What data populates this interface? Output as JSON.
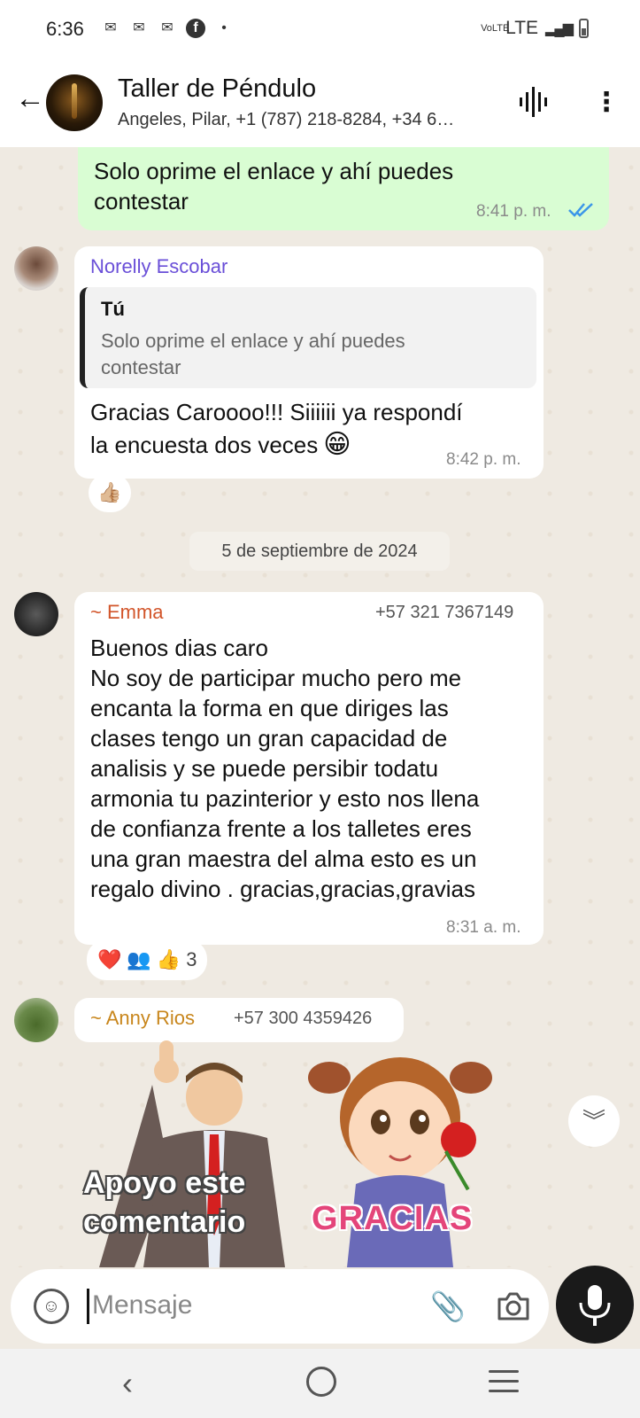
{
  "status_bar": {
    "time": "6:36",
    "network": "LTE",
    "volte": "VoLTE"
  },
  "header": {
    "title": "Taller de Péndulo",
    "subtitle": "Angeles, Pilar, +1 (787) 218-8284, +34 6…"
  },
  "messages": {
    "outgoing_1": {
      "text_line1": "Solo oprime el enlace y ahí puedes",
      "text_line2": "contestar",
      "time": "8:41 p. m."
    },
    "norelly": {
      "sender": "Norelly Escobar",
      "quote_author": "Tú",
      "quote_line1": "Solo oprime el enlace y ahí puedes",
      "quote_line2": "contestar",
      "text_line1": "Gracias Caroooo!!! Siiiiii ya respondí",
      "text_line2": "la encuesta dos veces",
      "emoji": "😁",
      "time": "8:42 p. m.",
      "reaction": "👍🏼"
    },
    "date_separator": "5 de septiembre de 2024",
    "emma": {
      "sender": "~ Emma",
      "phone": "+57 321 7367149",
      "lines": [
        "Buenos dias caro",
        "No soy de participar mucho pero me",
        "encanta  la forma en que diriges las",
        "clases tengo un gran capacidad de",
        "analisis y se puede persibir  todatu",
        "armonia  tu pazinterior y esto nos llena",
        "de confianza frente a los talletes eres",
        "una gran maestra del alma esto es un",
        "regalo divino . gracias,gracias,gravias"
      ],
      "time": "8:31 a. m.",
      "reactions": [
        "❤️",
        "👥",
        "👍"
      ],
      "reaction_count": "3"
    },
    "anny": {
      "sender": "~ Anny Rios",
      "phone": "+57 300 4359426",
      "sticker1_line1": "Apoyo este",
      "sticker1_line2": "comentario",
      "sticker2_text": "GRACIAS"
    }
  },
  "input": {
    "placeholder": "Mensaje"
  },
  "colors": {
    "outgoing_bubble": "#d9fdd3",
    "norelly_name": "#6a4fd8",
    "emma_name": "#d2552a",
    "anny_name": "#c8861c",
    "read_ticks": "#3b96e8"
  }
}
